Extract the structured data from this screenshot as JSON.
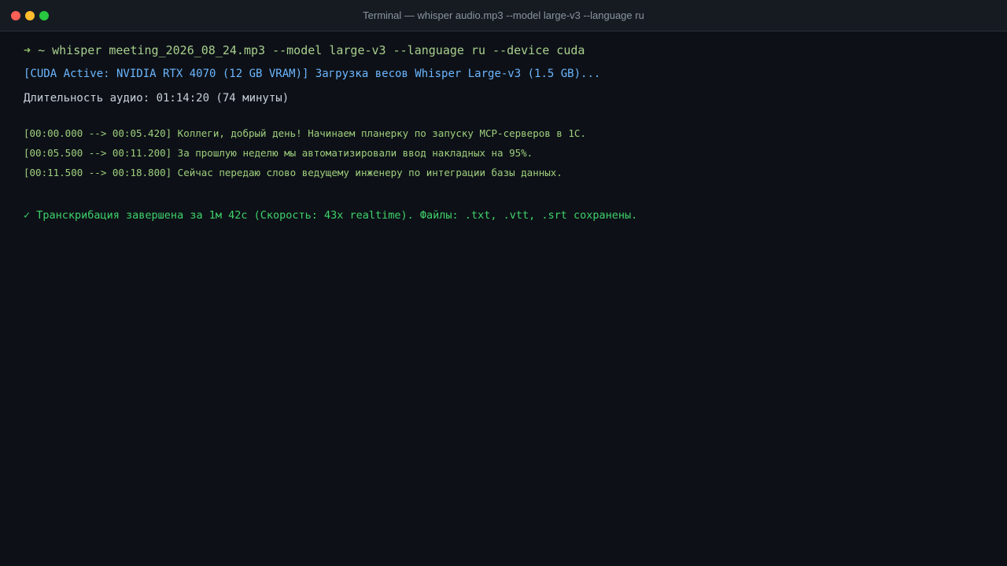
{
  "window": {
    "title": "Terminal — whisper audio.mp3 --model large-v3 --language ru"
  },
  "terminal": {
    "prompt_symbol": "➜",
    "prompt_dir": "~",
    "command": "whisper meeting_2026_08_24.mp3 --model large-v3 --language ru --device cuda",
    "cuda_info": "[CUDA Active: NVIDIA RTX 4070 (12 GB VRAM)] Загрузка весов Whisper Large-v3 (1.5 GB)...",
    "duration": "Длительность аудио: 01:14:20 (74 минуты)",
    "segments": [
      {
        "text": "[00:00.000 --> 00:05.420] Коллеги, добрый день! Начинаем планерку по запуску MCP-серверов в 1С."
      },
      {
        "text": "[00:05.500 --> 00:11.200] За прошлую неделю мы автоматизировали ввод накладных на 95%."
      },
      {
        "text": "[00:11.500 --> 00:18.800] Сейчас передаю слово ведущему инженеру по интеграции базы данных."
      }
    ],
    "completion": "✓ Транскрибация завершена за 1м 42с (Скорость: 43x realtime). Файлы: .txt, .vtt, .srt сохранены."
  },
  "colors": {
    "background": "#0d1117",
    "titlebar": "#161b22",
    "command": "#a8cf8e",
    "info": "#6cb6ff",
    "segment": "#9fcf7d",
    "success": "#3fd16a"
  }
}
